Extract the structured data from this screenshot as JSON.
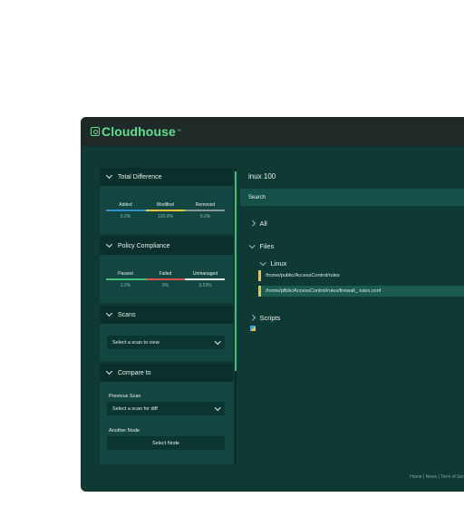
{
  "app": {
    "logo_text": "Cloudhouse",
    "logo_tm": "™"
  },
  "sidebar": {
    "total_difference": {
      "header": "Total Difference",
      "labels": [
        "Added",
        "Modified",
        "Removed"
      ],
      "values": [
        "0.0%",
        "100.0%",
        "0.0%"
      ],
      "bar_colors": [
        "#2e8fd6",
        "#e6c43a",
        "#8a9a98"
      ]
    },
    "policy_compliance": {
      "header": "Policy Compliance",
      "labels": [
        "Passed",
        "Failed",
        "Unmanaged"
      ],
      "values": [
        "1.0%",
        "0%",
        "3.53%"
      ],
      "bar_colors": [
        "#3fbf7a",
        "#d9534f",
        "#e8efec"
      ]
    },
    "scans": {
      "header": "Scans",
      "select_placeholder": "Select a scan to view"
    },
    "compare_to": {
      "header": "Compare to",
      "previous_scan_label": "Previous Scan",
      "previous_scan_placeholder": "Select a scan for diff",
      "another_node_label": "Another Node",
      "select_node_button": "Select Node"
    }
  },
  "main": {
    "node_title": "inux 100",
    "search_placeholder": "Search",
    "tree": {
      "all": "All",
      "files": "Files",
      "linux": "Linux",
      "file_1": "/home/public/AccessControl/rules",
      "file_2": "/home/pfblic/AccessControl/rules/firewall_ rules.conf",
      "scripts": "Scripts"
    }
  },
  "footer": {
    "text": "Home  |  News  |  Term of Ser"
  },
  "colors": {
    "accent": "#5fe08d",
    "background": "#0f3a34",
    "modified": "#e6c43a"
  }
}
